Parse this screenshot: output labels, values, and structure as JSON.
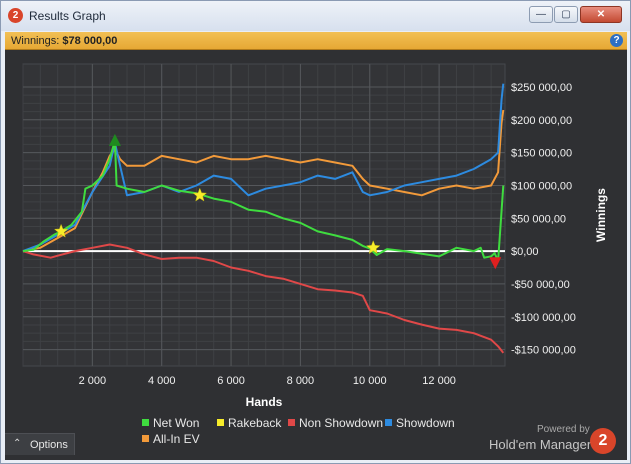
{
  "window": {
    "title": "Results Graph",
    "app_icon": "2",
    "controls": {
      "minimize": "—",
      "maximize": "▢",
      "close": "✕"
    }
  },
  "winnings": {
    "label": "Winnings:",
    "value": "$78 000,00",
    "help": "?"
  },
  "options": {
    "caret": "⌃",
    "label": "Options"
  },
  "brand": {
    "powered_by": "Powered by",
    "name": "Hold'em Manager",
    "logo": "2"
  },
  "chart_data": {
    "type": "line",
    "xlabel": "Hands",
    "ylabel": "Winnings",
    "xlim": [
      0,
      13900
    ],
    "ylim": [
      -175000,
      285000
    ],
    "x_ticks": [
      2000,
      4000,
      6000,
      8000,
      10000,
      12000
    ],
    "x_tick_labels": [
      "2 000",
      "4 000",
      "6 000",
      "8 000",
      "10 000",
      "12 000"
    ],
    "y_ticks": [
      250000,
      200000,
      150000,
      100000,
      50000,
      0,
      -50000,
      -100000,
      -150000
    ],
    "y_tick_labels": [
      "$250 000,00",
      "$200 000,00",
      "$150 000,00",
      "$100 000,00",
      "$50 000,00",
      "$0,00",
      "-$50 000,00",
      "-$100 000,00",
      "-$150 000,00"
    ],
    "grid": true,
    "legend_position": "bottom",
    "series": [
      {
        "name": "Net Won",
        "color": "#3fdc3f",
        "x": [
          0,
          300,
          600,
          900,
          1100,
          1400,
          1700,
          1800,
          2000,
          2300,
          2500,
          2650,
          2700,
          3000,
          3500,
          4000,
          4500,
          5000,
          5500,
          6000,
          6500,
          7000,
          7500,
          8000,
          8500,
          9000,
          9500,
          9800,
          10000,
          10200,
          10500,
          11000,
          11500,
          12000,
          12500,
          13000,
          13200,
          13300,
          13500,
          13600,
          13700,
          13800,
          13850
        ],
        "y": [
          0,
          2000,
          15000,
          25000,
          30000,
          40000,
          60000,
          95000,
          100000,
          115000,
          140000,
          168000,
          100000,
          95000,
          90000,
          100000,
          92000,
          88000,
          80000,
          75000,
          63000,
          60000,
          50000,
          43000,
          30000,
          24000,
          17000,
          8000,
          4000,
          -6000,
          3000,
          0,
          -4000,
          -8000,
          5000,
          0,
          5000,
          -10000,
          -8000,
          -3000,
          -15000,
          60000,
          100000
        ]
      },
      {
        "name": "Rakeback",
        "color": "#f7ec2a",
        "x": [
          1100,
          5100,
          10100
        ],
        "y": [
          30000,
          85000,
          5000
        ]
      },
      {
        "name": "Non Showdown",
        "color": "#e04848",
        "x": [
          0,
          300,
          800,
          1000,
          1500,
          2000,
          2500,
          3000,
          3500,
          4000,
          4500,
          5000,
          5500,
          6000,
          6500,
          7000,
          7500,
          8000,
          8500,
          9000,
          9500,
          9800,
          10000,
          10500,
          11000,
          11500,
          12000,
          12500,
          13000,
          13500,
          13700,
          13850
        ],
        "y": [
          0,
          -5000,
          -10000,
          -7000,
          0,
          5000,
          10000,
          5000,
          -5000,
          -12000,
          -10000,
          -10000,
          -15000,
          -25000,
          -30000,
          -38000,
          -42000,
          -50000,
          -58000,
          -60000,
          -63000,
          -68000,
          -90000,
          -95000,
          -105000,
          -112000,
          -118000,
          -120000,
          -125000,
          -135000,
          -145000,
          -155000
        ]
      },
      {
        "name": "Showdown",
        "color": "#2d8be0",
        "x": [
          0,
          500,
          1000,
          1500,
          2000,
          2500,
          2650,
          2800,
          3000,
          3500,
          4000,
          4500,
          5000,
          5500,
          6000,
          6500,
          7000,
          7500,
          8000,
          8500,
          9000,
          9500,
          9800,
          10000,
          10500,
          11000,
          11500,
          12000,
          12500,
          13000,
          13500,
          13700,
          13800,
          13850
        ],
        "y": [
          0,
          10000,
          25000,
          40000,
          90000,
          130000,
          165000,
          130000,
          85000,
          90000,
          100000,
          90000,
          100000,
          115000,
          110000,
          85000,
          95000,
          100000,
          105000,
          115000,
          110000,
          120000,
          90000,
          85000,
          90000,
          100000,
          105000,
          110000,
          115000,
          125000,
          140000,
          150000,
          230000,
          255000
        ]
      },
      {
        "name": "All-In EV",
        "color": "#f29a3a",
        "x": [
          0,
          500,
          1000,
          1500,
          2000,
          2300,
          2500,
          2650,
          2800,
          3000,
          3500,
          4000,
          4500,
          5000,
          5500,
          6000,
          6500,
          7000,
          7500,
          8000,
          8500,
          9000,
          9500,
          9800,
          10000,
          10500,
          11000,
          11500,
          12000,
          12500,
          13000,
          13500,
          13700,
          13800,
          13850
        ],
        "y": [
          0,
          5000,
          20000,
          35000,
          90000,
          120000,
          145000,
          155000,
          140000,
          130000,
          130000,
          145000,
          140000,
          135000,
          145000,
          140000,
          140000,
          145000,
          140000,
          135000,
          140000,
          135000,
          130000,
          110000,
          100000,
          95000,
          90000,
          85000,
          95000,
          100000,
          95000,
          100000,
          120000,
          195000,
          215000
        ]
      }
    ],
    "markers": [
      {
        "label": "peak",
        "color": "#1f8a1f",
        "x": 2650,
        "y": 168000,
        "direction": "up"
      },
      {
        "label": "low",
        "color": "#e02020",
        "x": 13620,
        "y": -17000,
        "direction": "down"
      }
    ]
  }
}
